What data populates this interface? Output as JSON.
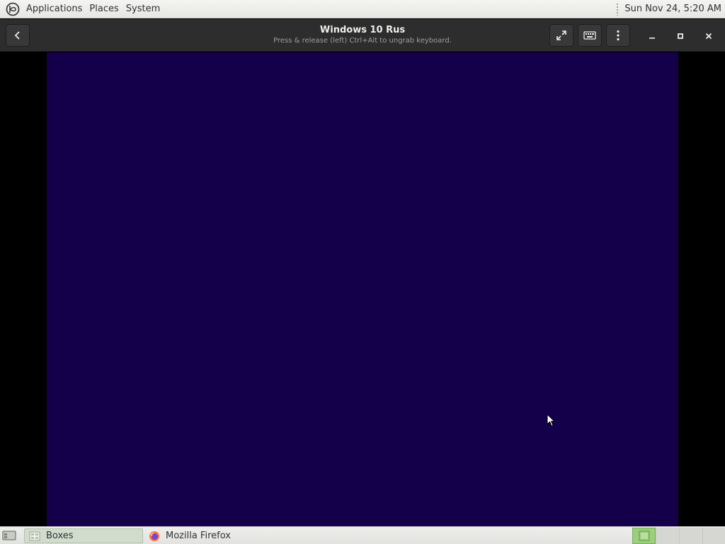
{
  "top_panel": {
    "menus": [
      "Applications",
      "Places",
      "System"
    ],
    "clock": "Sun Nov 24,  5:20 AM"
  },
  "window": {
    "title": "Windows 10 Rus",
    "subtitle": "Press & release (left) Ctrl+Alt to ungrab keyboard."
  },
  "icons": {
    "logo": "distro-logo-icon",
    "back": "back-arrow-icon",
    "fullscreen": "fullscreen-icon",
    "keyboard": "keyboard-icon",
    "menu": "vertical-dots-icon",
    "minimize": "minimize-icon",
    "maximize": "maximize-icon",
    "close": "close-icon"
  },
  "vm": {
    "background_color": "#14004a"
  },
  "taskbar": {
    "tasks": [
      {
        "label": "Boxes",
        "icon": "boxes-icon",
        "active": true
      },
      {
        "label": "Mozilla Firefox",
        "icon": "firefox-icon",
        "active": false
      }
    ],
    "workspaces": 4,
    "active_workspace": 1
  },
  "colors": {
    "headerbar": "#2d2d2d",
    "panel": "#eeeeec",
    "workspace_active": "#9bcf7e"
  }
}
